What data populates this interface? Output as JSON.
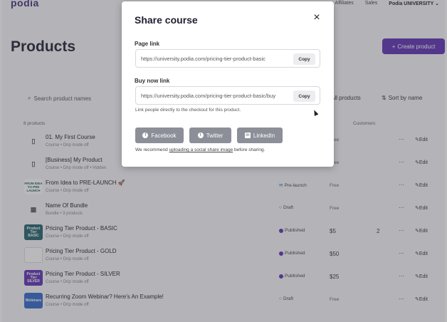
{
  "topbar": {
    "logo": "podia",
    "nav": [
      "Affiliates",
      "Sales"
    ],
    "account": "Podia UNIVERSITY"
  },
  "page": {
    "title": "Products",
    "create_button": "Create product",
    "create_icon": "+"
  },
  "toolbar": {
    "search_placeholder": "Search product names",
    "filter_label": "All products",
    "sort_label": "Sort by name"
  },
  "list": {
    "count_label": "8 products",
    "status_header": "Status",
    "customers_header": "Customers",
    "rows": [
      {
        "title": "01. My First Course",
        "sub": "Course • Drip mode off",
        "status": "",
        "price": "Free",
        "customers": "",
        "thumb": "doc-icon"
      },
      {
        "title": "[Business] My Product",
        "sub": "Course • Drip mode off • Hidden",
        "status": "",
        "price": "Free",
        "customers": "",
        "thumb": "doc-icon"
      },
      {
        "title": "From Idea to PRE-LAUNCH 🚀",
        "sub": "Course • Drip mode off",
        "status": "Pre-launch",
        "price": "Free",
        "customers": "",
        "thumb_text": "FROM IDEA TO PRE LAUNCH"
      },
      {
        "title": "Name Of Bundle",
        "sub": "Bundle • 3 products",
        "status": "Draft",
        "price": "Free",
        "customers": "",
        "thumb": "bundle-icon"
      },
      {
        "title": "Pricing Tier Product - BASIC",
        "sub": "Course • Drip mode off",
        "status": "Published",
        "price": "$5",
        "customers": "2",
        "thumb_text": "Product Tier BASIC"
      },
      {
        "title": "Pricing Tier Product - GOLD",
        "sub": "Course • Drip mode off",
        "status": "Published",
        "price": "$50",
        "customers": "",
        "thumb_text": ""
      },
      {
        "title": "Pricing Tier Product - SILVER",
        "sub": "Course • Drip mode off",
        "status": "Published",
        "price": "$25",
        "customers": "",
        "thumb_text": "Product Tier SILVER"
      },
      {
        "title": "Recurring Zoom Webinar? Here's An Example!",
        "sub": "Course • Drip mode off",
        "status": "Draft",
        "price": "Free",
        "customers": "",
        "thumb_text": "Webinars"
      }
    ],
    "more_label": "···",
    "edit_label": "Edit"
  },
  "modal": {
    "title": "Share course",
    "page_link_label": "Page link",
    "page_link_url": "https://university.podia.com/pricing-tier-product-basic",
    "buy_now_label": "Buy now link",
    "buy_now_url": "https://university.podia.com/pricing-tier-product-basic/buy",
    "copy_label": "Copy",
    "buy_helper": "Link people directly to the checkout for this product.",
    "share_buttons": [
      "Facebook",
      "Twitter",
      "LinkedIn"
    ],
    "recommend_prefix": "We recommend ",
    "recommend_link": "uploading a social share image",
    "recommend_suffix": " before sharing."
  },
  "colors": {
    "accent": "#5b2eb0",
    "overlay": "#464650",
    "share_button": "#8c8f97",
    "published": "#5b2eb0",
    "prelaunch": "#2f67c8"
  }
}
